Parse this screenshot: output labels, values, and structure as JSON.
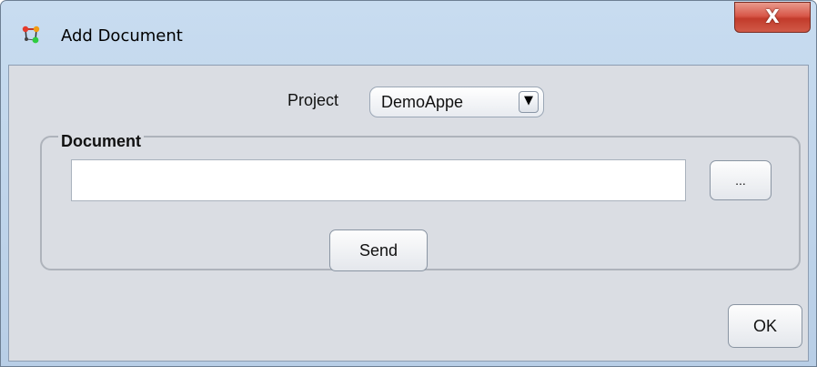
{
  "window": {
    "title": "Add Document",
    "app_icon": "network-nodes-icon",
    "close_label": "X"
  },
  "project": {
    "label": "Project",
    "selected": "DemoAppe",
    "arrow": "▼"
  },
  "document_group": {
    "legend": "Document",
    "path_value": "",
    "browse_label": "...",
    "send_label": "Send"
  },
  "footer": {
    "ok_label": "OK"
  },
  "colors": {
    "titlebar": "#c4d9ee",
    "client_bg": "#dadde3",
    "close_button": "#c94a3a"
  }
}
